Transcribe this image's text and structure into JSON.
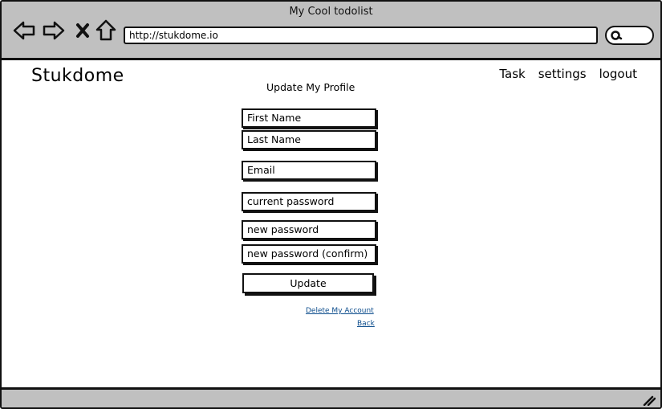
{
  "browser": {
    "title": "My Cool todolist",
    "url": "http://stukdome.io"
  },
  "header": {
    "brand": "Stukdome",
    "nav": [
      "Task",
      "settings",
      "logout"
    ]
  },
  "form": {
    "title": "Update My Profile",
    "fields": {
      "first_name": "First Name",
      "last_name": "Last Name",
      "email": "Email",
      "current_password": "current password",
      "new_password": "new password",
      "new_password_confirm": "new password (confirm)"
    },
    "update_label": "Update",
    "delete_link": "Delete My Account",
    "back_link": "Back"
  },
  "icons": [
    "back-arrow-icon",
    "forward-arrow-icon",
    "close-icon",
    "home-icon",
    "search-icon",
    "resize-grip-icon"
  ]
}
